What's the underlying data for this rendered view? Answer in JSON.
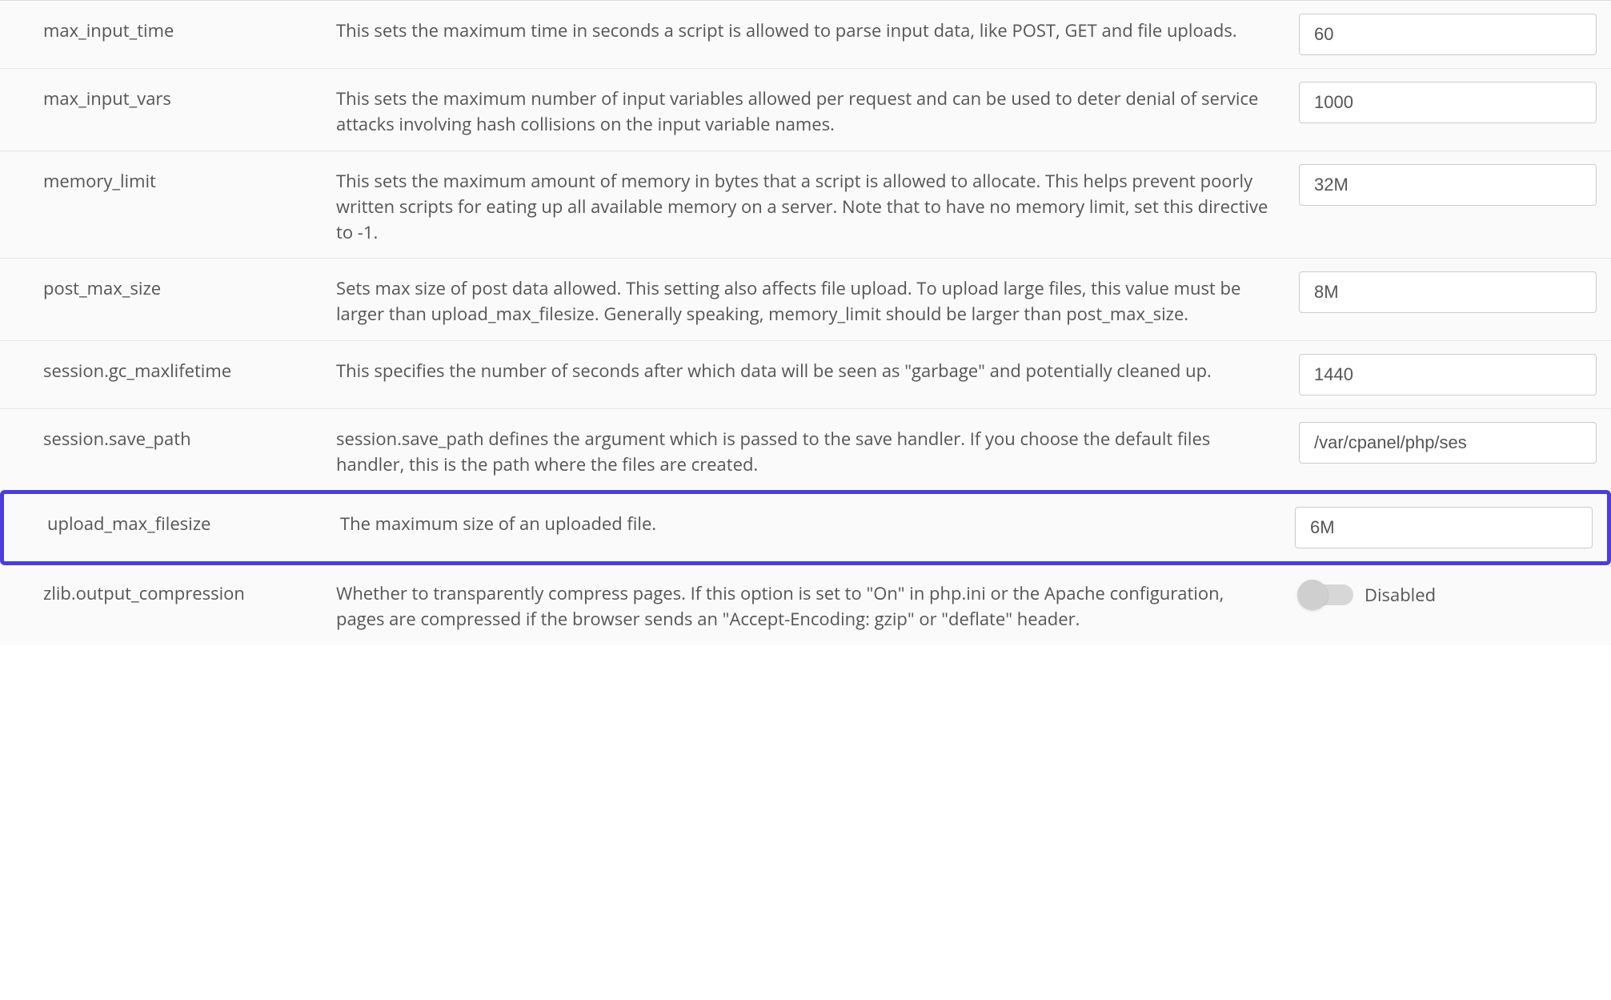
{
  "rows": [
    {
      "name": "max_input_time",
      "desc": "This sets the maximum time in seconds a script is allowed to parse input data, like POST, GET and file uploads.",
      "value": "60",
      "control": "text"
    },
    {
      "name": "max_input_vars",
      "desc": "This sets the maximum number of input variables allowed per request and can be used to deter denial of service attacks involving hash collisions on the input variable names.",
      "value": "1000",
      "control": "text"
    },
    {
      "name": "memory_limit",
      "desc": "This sets the maximum amount of memory in bytes that a script is allowed to allocate. This helps prevent poorly written scripts for eating up all available memory on a server. Note that to have no memory limit, set this directive to -1.",
      "value": "32M",
      "control": "text"
    },
    {
      "name": "post_max_size",
      "desc": "Sets max size of post data allowed. This setting also affects file upload. To upload large files, this value must be larger than upload_max_filesize. Generally speaking, memory_limit should be larger than post_max_size.",
      "value": "8M",
      "control": "text"
    },
    {
      "name": "session.gc_maxlifetime",
      "desc": "This specifies the number of seconds after which data will be seen as \"garbage\" and potentially cleaned up.",
      "value": "1440",
      "control": "text"
    },
    {
      "name": "session.save_path",
      "desc": "session.save_path defines the argument which is passed to the save handler. If you choose the default files handler, this is the path where the files are created.",
      "value": "/var/cpanel/php/ses",
      "control": "text"
    },
    {
      "name": "upload_max_filesize",
      "desc": "The maximum size of an uploaded file.",
      "value": "6M",
      "control": "text",
      "highlight": true
    },
    {
      "name": "zlib.output_compression",
      "desc": "Whether to transparently compress pages. If this option is set to \"On\" in php.ini or the Apache configuration, pages are compressed if the browser sends an \"Accept-Encoding: gzip\" or \"deflate\" header.",
      "value": "Disabled",
      "control": "toggle"
    }
  ]
}
